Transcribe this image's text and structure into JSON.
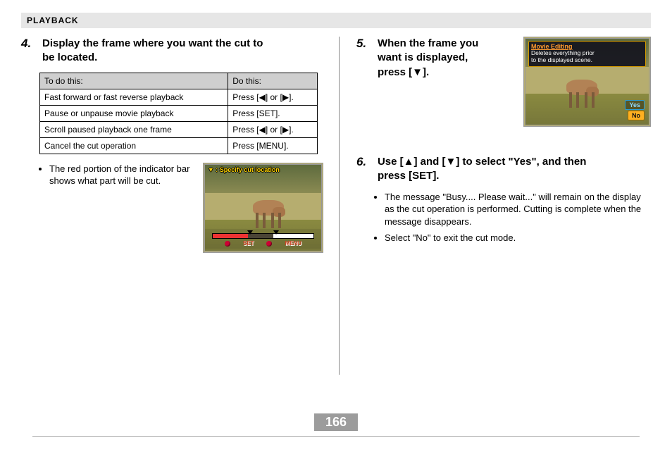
{
  "section_header": "PLAYBACK",
  "page_number": "166",
  "left": {
    "step4": {
      "num": "4.",
      "text": "Display the frame where you want the cut to\nbe located."
    },
    "table": {
      "headers": [
        "To do this:",
        "Do this:"
      ],
      "rows": [
        [
          "Fast forward or fast reverse playback",
          "Press [◀] or [▶]."
        ],
        [
          "Pause or unpause movie playback",
          "Press [SET]."
        ],
        [
          "Scroll paused playback one frame",
          "Press [◀] or [▶]."
        ],
        [
          "Cancel the cut operation",
          "Press [MENU]."
        ]
      ]
    },
    "note1": "The red portion of the indicator bar shows what part will be cut.",
    "screenshot": {
      "overlay_label": "▼ : Specify cut location",
      "btn_set": "SET",
      "btn_menu": "MENU"
    }
  },
  "right": {
    "step5": {
      "num": "5.",
      "text": "When the frame you\nwant is displayed,\npress [▼]."
    },
    "confirm": {
      "title": "Movie Editing",
      "message": "Deletes everything prior\nto the displayed scene.",
      "yes": "Yes",
      "no": "No"
    },
    "step6": {
      "num": "6.",
      "text": "Use [▲] and [▼] to select \"Yes\", and then\npress [SET]."
    },
    "bullets": [
      "The message \"Busy.... Please wait...\" will remain on the display as the cut operation is performed. Cutting is complete when the message disappears.",
      "Select \"No\" to exit the cut mode."
    ]
  }
}
